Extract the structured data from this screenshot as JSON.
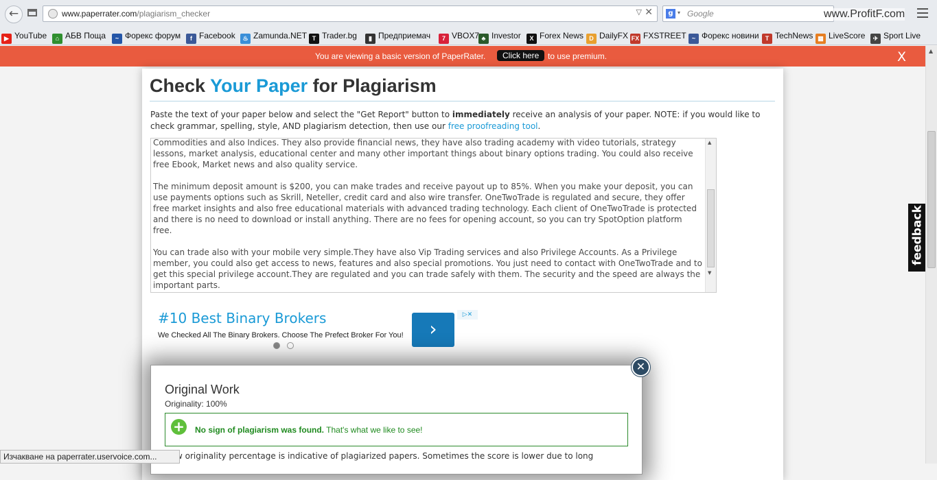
{
  "browser": {
    "url_domain": "www.paperrater.com",
    "url_path": "/plagiarism_checker",
    "search_placeholder": "Google",
    "watermark": "www.ProfitF.com",
    "bookmarks": [
      {
        "label": "YouTube",
        "color": "#e62117",
        "glyph": "▶"
      },
      {
        "label": "АБВ Поща",
        "color": "#2f8f2f",
        "glyph": "⌂"
      },
      {
        "label": "Форекс форум",
        "color": "#2456a8",
        "glyph": "~"
      },
      {
        "label": "Facebook",
        "color": "#3b5998",
        "glyph": "f"
      },
      {
        "label": "Zamunda.NET",
        "color": "#3a8fd8",
        "glyph": "♨"
      },
      {
        "label": "Trader.bg",
        "color": "#111111",
        "glyph": "T"
      },
      {
        "label": "Предприемач",
        "color": "#333333",
        "glyph": "▮"
      },
      {
        "label": "VBOX7",
        "color": "#d8213a",
        "glyph": "7"
      },
      {
        "label": "Investor",
        "color": "#2a5a2a",
        "glyph": "♣"
      },
      {
        "label": "Forex News",
        "color": "#111111",
        "glyph": "X"
      },
      {
        "label": "DailyFX",
        "color": "#e8a030",
        "glyph": "D"
      },
      {
        "label": "FXSTREET",
        "color": "#c0392b",
        "glyph": "FX"
      },
      {
        "label": "Форекс новини",
        "color": "#3b5998",
        "glyph": "~"
      },
      {
        "label": "TechNews",
        "color": "#c0392b",
        "glyph": "T"
      },
      {
        "label": "LiveScore",
        "color": "#e67e22",
        "glyph": "▦"
      },
      {
        "label": "Sport Live",
        "color": "#444444",
        "glyph": "✈"
      }
    ]
  },
  "premium_bar": {
    "text_before": "You are viewing a basic version of PaperRater.",
    "button_label": "Click here",
    "text_after": "to use premium.",
    "close_label": "X"
  },
  "page": {
    "title_part1": "Check",
    "title_part2": "Your Paper",
    "title_part3": "for Plagiarism",
    "intro_1": "Paste the text of your paper below and select the \"Get Report\" button to",
    "intro_bold": "immediately",
    "intro_2": "receive an analysis of your paper. NOTE: if you would like to check grammar, spelling, style, AND plagiarism detection, then use our",
    "intro_link": "free proofreading tool",
    "intro_end": ".",
    "paper_paragraphs": [
      "Commodities and also Indices. They also provide financial news, they have also trading academy with video tutorials, strategy lessons, market analysis, educational center and many other important things about binary options trading. You could also receive free Ebook, Market news and also quality service.",
      "The minimum deposit amount is $200, you can make trades and receive payout up to 85%. When you make your deposit, you can use payments options such as Skrill, Neteller, credit card and also wire transfer. OneTwoTrade is regulated and secure, they offer free market insights and also free educational materials with advanced trading technology. Each client of OneTwoTrade is protected and there is no need to download or install anything. There are no fees for opening account, so you can try SpotOption platform free.",
      "You can trade also with your mobile very simple.They have also Vip Trading services and also Privilege Accounts. As a Privilege member, you could also get access to news, features and also special promotions. You just need to contact with OneTwoTrade and to get this special privilege account.They are regulated and you can trade safely with them. The security and the speed are always the important parts."
    ]
  },
  "ad": {
    "title": "#10 Best Binary Brokers",
    "subtitle": "We Checked All The Binary Brokers. Choose The Prefect Broker For You!",
    "arrow": "›",
    "choice": "▷✕"
  },
  "modal": {
    "close_label": "✕",
    "title": "Original Work",
    "originality": "Originality: 100%",
    "result_bold": "No sign of plagiarism was found.",
    "result_rest": "That's what we like to see!",
    "low_text": "w originality percentage is indicative of plagiarized papers. Sometimes the score is lower due to long"
  },
  "status_bar": "Изчакване на paperrater.uservoice.com...",
  "feedback": "feedback"
}
